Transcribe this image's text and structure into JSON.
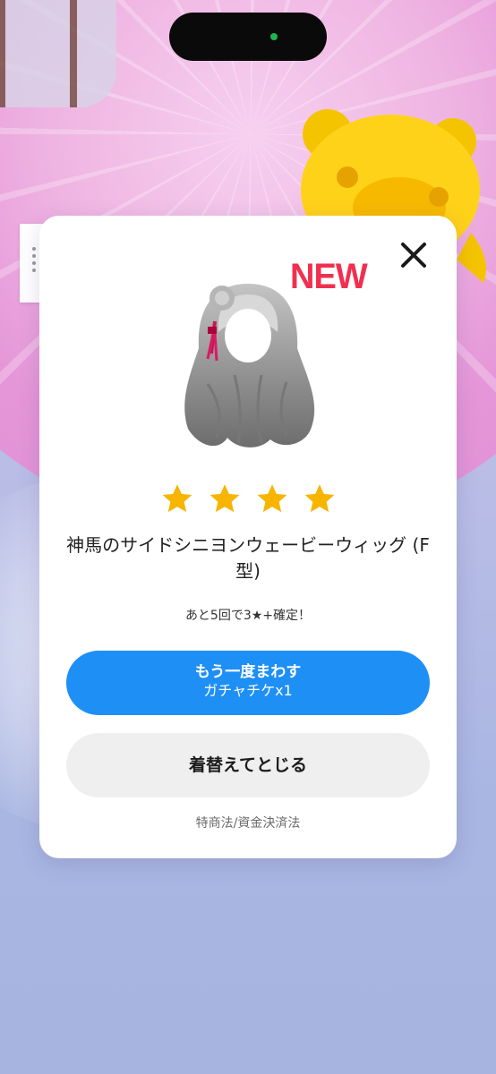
{
  "status_bar": {
    "camera_indicator_color": "#1fb64f"
  },
  "dialog": {
    "badge": "NEW",
    "close_icon": "close-icon",
    "item_image": "gray-wavy-wig-illustration",
    "rarity_stars": 4,
    "star_color": "#f7b500",
    "item_name": "神馬のサイドシニヨンウェービーウィッグ (F型)",
    "guarantee_text": "あと5回で3★+確定！",
    "spin_again_button": {
      "label": "もう一度まわす",
      "cost": "ガチャチケx1",
      "color": "#1e8ff5"
    },
    "equip_close_button": {
      "label": "着替えてとじる"
    },
    "legal_link": "特商法/資金決済法"
  },
  "badge_color": "#f0304f"
}
